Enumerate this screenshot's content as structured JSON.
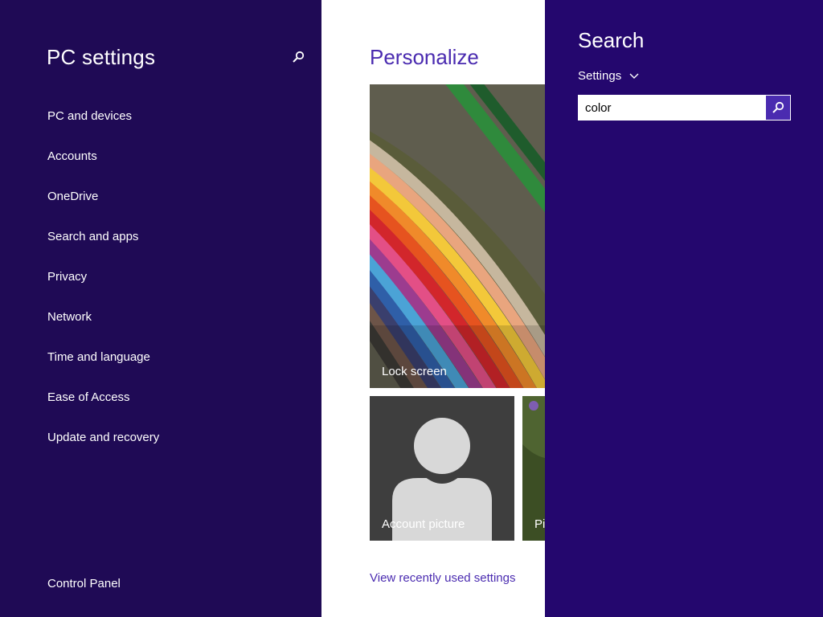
{
  "nav": {
    "title": "PC settings",
    "items": [
      {
        "label": "PC and devices"
      },
      {
        "label": "Accounts"
      },
      {
        "label": "OneDrive"
      },
      {
        "label": "Search and apps"
      },
      {
        "label": "Privacy"
      },
      {
        "label": "Network"
      },
      {
        "label": "Time and language"
      },
      {
        "label": "Ease of Access"
      },
      {
        "label": "Update and recovery"
      }
    ],
    "footer": "Control Panel",
    "search_icon": "search-icon"
  },
  "content": {
    "title": "Personalize",
    "tiles": {
      "lock_screen": "Lock screen",
      "account_picture": "Account picture",
      "picture_password": "Pi"
    },
    "recent_link": "View recently used settings"
  },
  "search": {
    "title": "Search",
    "scope": "Settings",
    "query": "color",
    "go_icon": "search-icon"
  },
  "colors": {
    "nav_bg": "#1f0a55",
    "search_bg": "#24076e",
    "accent": "#4a2bb0"
  }
}
